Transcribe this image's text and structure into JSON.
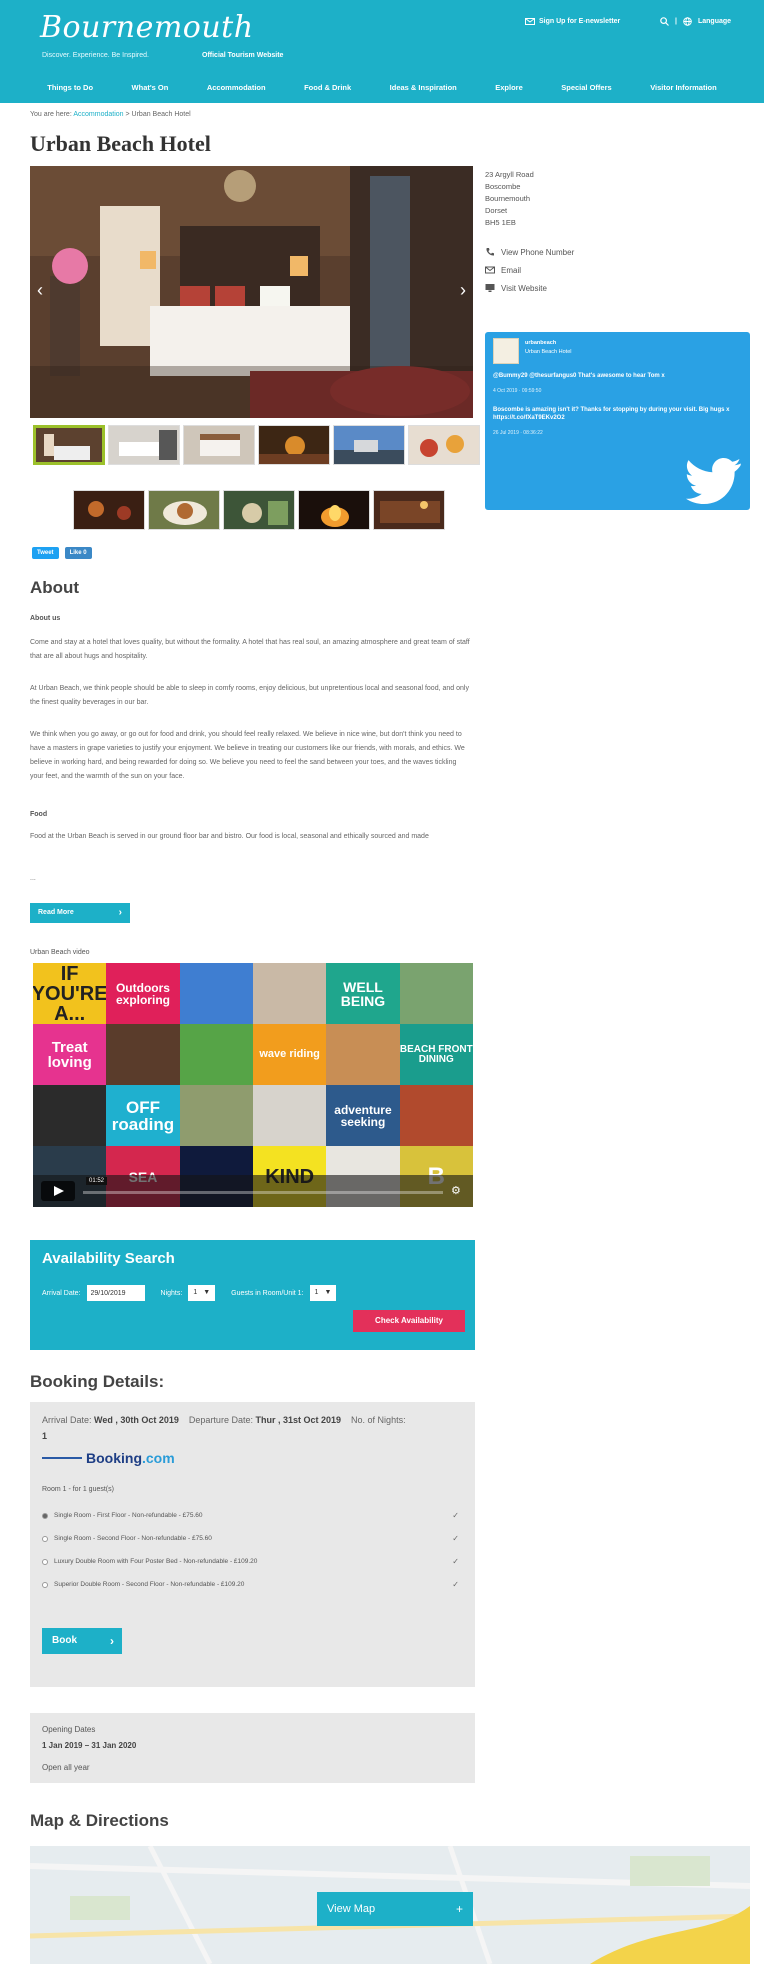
{
  "header": {
    "logo": "Bournemouth",
    "tagline": "Discover. Experience. Be Inspired.",
    "official": "Official Tourism Website",
    "newsletter": "Sign Up for E-newsletter",
    "language": "Language"
  },
  "nav": [
    "Things to Do",
    "What's On",
    "Accommodation",
    "Food & Drink",
    "Ideas & Inspiration",
    "Explore",
    "Special Offers",
    "Visitor Information"
  ],
  "breadcrumb": {
    "prefix": "You are here:",
    "link": "Accommodation",
    "separator": ">",
    "current": "Urban Beach Hotel"
  },
  "page_title": "Urban Beach Hotel",
  "gallery": {
    "prev_icon": "‹",
    "next_icon": "›"
  },
  "social": {
    "tweet": "Tweet",
    "like": "Like 0"
  },
  "address": [
    "23 Argyll Road",
    "Boscombe",
    "Bournemouth",
    "Dorset",
    "BH5 1EB"
  ],
  "contact": {
    "phone": "View Phone Number",
    "email": "Email",
    "website": "Visit Website"
  },
  "twitter": {
    "handle": "urbanbeach",
    "name": "Urban Beach Hotel",
    "tweets": [
      {
        "text": "@Bummy29 @thesurfangus0 That's awesome to hear Tom x",
        "date": "4 Oct 2019 · 09:59:50"
      },
      {
        "text": "Boscombe is amazing isn't it? Thanks for stopping by during your visit. Big hugs x https://t.co/fXaT9EKv2O2",
        "date": "26 Jul 2019 · 08:36:22"
      }
    ]
  },
  "about": {
    "title": "About",
    "subhead": "About us",
    "paragraphs": [
      "Come and stay at a hotel that loves quality, but without the formality. A hotel that has real soul, an amazing atmosphere and great team of staff that are all about hugs and hospitality.",
      "At Urban Beach, we think people should be able to sleep in comfy rooms, enjoy delicious, but unpretentious local and seasonal food, and only the finest quality beverages in our bar.",
      "We think when you go away, or go out for food and drink, you should feel really relaxed. We believe in nice wine, but don't think you need to have a masters in grape varieties to justify your enjoyment. We believe in treating our customers like our friends, with morals, and ethics. We believe in working hard, and being rewarded for doing so. We believe you need to feel the sand between your toes, and the waves tickling your feet, and the warmth of the sun on your face."
    ],
    "food_head": "Food",
    "food_text": "Food at the Urban Beach is served in our ground floor bar and bistro. Our food is local, seasonal and ethically sourced and made",
    "ellipsis": "...",
    "read_more": "Read More"
  },
  "video": {
    "label": "Urban Beach video",
    "time": "01:52",
    "gear_icon": "⚙",
    "tiles": [
      "IF YOU'RE A...",
      "Outdoors exploring",
      "",
      "",
      "WELL BEING",
      "",
      "Treat loving",
      "",
      "",
      "wave riding",
      "",
      "BEACH FRONT DINING",
      "",
      "OFF roading",
      "",
      "",
      "adventure seeking",
      "",
      "",
      "SEA",
      "",
      "KIND",
      "",
      "B"
    ]
  },
  "availability": {
    "title": "Availability Search",
    "arrival_label": "Arrival Date:",
    "arrival_value": "29/10/2019",
    "nights_label": "Nights:",
    "nights_value": "1",
    "guests_label": "Guests in Room/Unit 1:",
    "guests_value": "1",
    "caret": "▼",
    "check_button": "Check Availability"
  },
  "booking": {
    "title": "Booking Details:",
    "arrival_label": "Arrival Date:",
    "arrival_value": "Wed , 30th Oct 2019",
    "departure_label": "Departure Date:",
    "departure_value": "Thur , 31st Oct 2019",
    "nights_label": "No. of Nights:",
    "nights_value": "1",
    "logo_main": "Booking",
    "logo_dot": ".com",
    "room_line": "Room 1 - for 1 guest(s)",
    "options": [
      "Single Room - First Floor - Non-refundable - £75.60",
      "Single Room - Second Floor - Non-refundable - £75.60",
      "Luxury Double Room with Four Poster Bed - Non-refundable - £109.20",
      "Superior Double Room - Second Floor - Non-refundable - £109.20"
    ],
    "check_icon": "✓",
    "book_button": "Book"
  },
  "opening": {
    "title": "Opening Dates",
    "range": "1 Jan 2019 – 31 Jan 2020",
    "note": "Open all year"
  },
  "map": {
    "title": "Map & Directions",
    "button": "View Map"
  }
}
